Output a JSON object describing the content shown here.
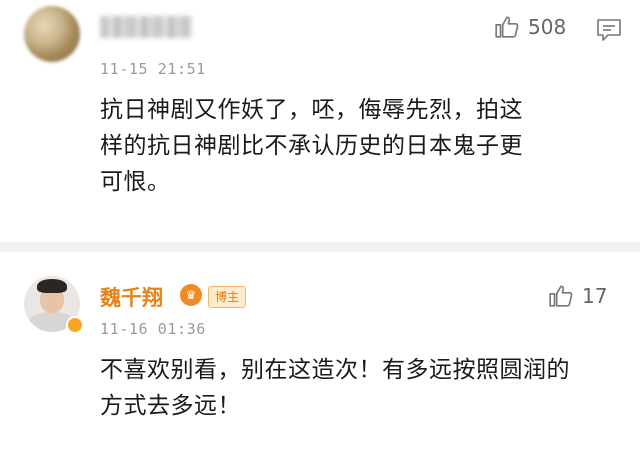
{
  "comments": [
    {
      "username": "",
      "timestamp": "11-15 21:51",
      "likes": "508",
      "text_lines": [
        "抗日神剧又作妖了，呸，侮辱先烈，拍这",
        "样的抗日神剧比不承认历史的日本鬼子更",
        "可恨。"
      ]
    },
    {
      "username": "魏千翔",
      "badge_vip_icon": "crown-vip-icon",
      "badge_fan_label": "博主",
      "timestamp": "11-16 01:36",
      "likes": "17",
      "text_lines": [
        "不喜欢别看，别在这造次！有多远按照圆润的",
        "方式去多远！"
      ]
    }
  ],
  "colors": {
    "username_accent": "#e8821a",
    "text": "#1a1a1a",
    "meta": "#9a9a9a",
    "divider": "#f2f2f2"
  }
}
